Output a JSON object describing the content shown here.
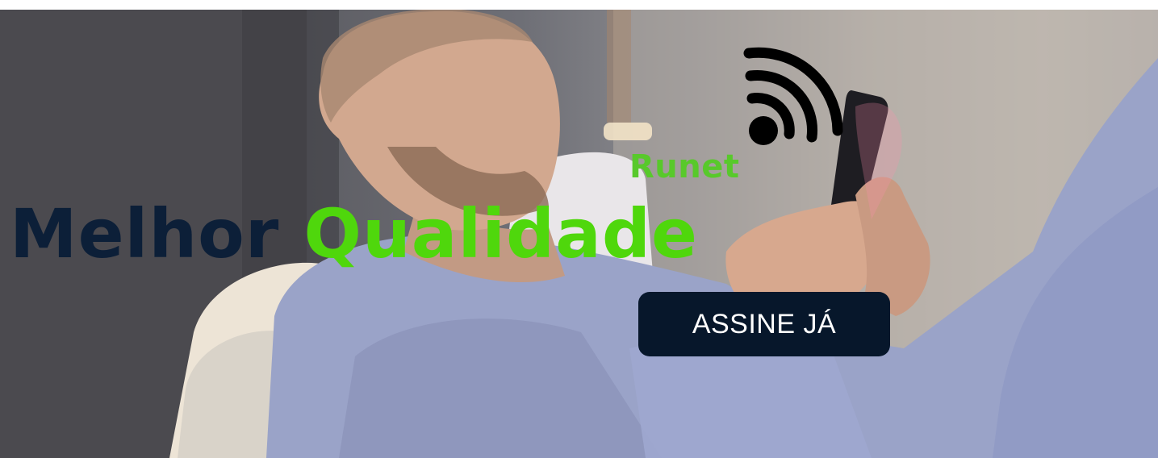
{
  "banner": {
    "headline_part1": "Melhor",
    "headline_part2": "Qualidade",
    "brand_name": "Runet",
    "cta_label": "ASSINE JÁ",
    "wifi_icon": "wifi-icon",
    "colors": {
      "headline_dark": "#0c1f38",
      "headline_accent": "#4fd70c",
      "brand": "#58c92b",
      "button_bg": "#07172b",
      "button_text": "#ffffff"
    }
  }
}
